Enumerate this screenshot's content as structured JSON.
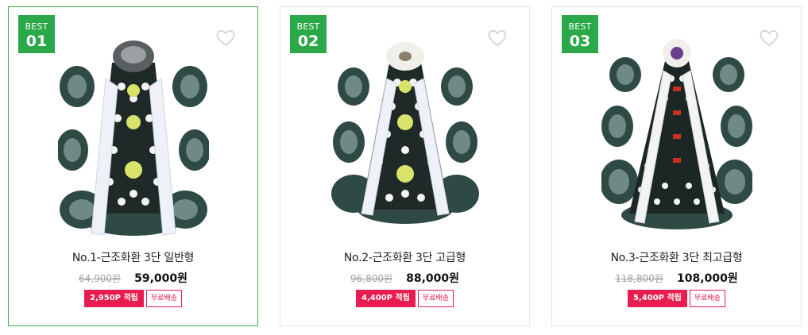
{
  "products": [
    {
      "badge_label": "BEST",
      "rank": "01",
      "title": "No.1-근조화환 3단 일반형",
      "original_price": "64,900원",
      "sale_price": "59,000원",
      "points": "2,950P 적립",
      "shipping": "무료배송",
      "image_icon": "funeral-wreath-image",
      "selected": true
    },
    {
      "badge_label": "BEST",
      "rank": "02",
      "title": "No.2-근조화환 3단 고급형",
      "original_price": "96,800원",
      "sale_price": "88,000원",
      "points": "4,400P 적립",
      "shipping": "무료배송",
      "image_icon": "funeral-wreath-image",
      "selected": false
    },
    {
      "badge_label": "BEST",
      "rank": "03",
      "title": "No.3-근조화환 3단 최고급형",
      "original_price": "118,800원",
      "sale_price": "108,000원",
      "points": "5,400P 적립",
      "shipping": "무료배송",
      "image_icon": "funeral-wreath-image",
      "selected": false
    }
  ],
  "colors": {
    "badge_green": "#2aa84a",
    "selected_border": "#3fae49",
    "points_red": "#e81c4f"
  },
  "icons": {
    "wishlist": "heart-outline-icon"
  }
}
